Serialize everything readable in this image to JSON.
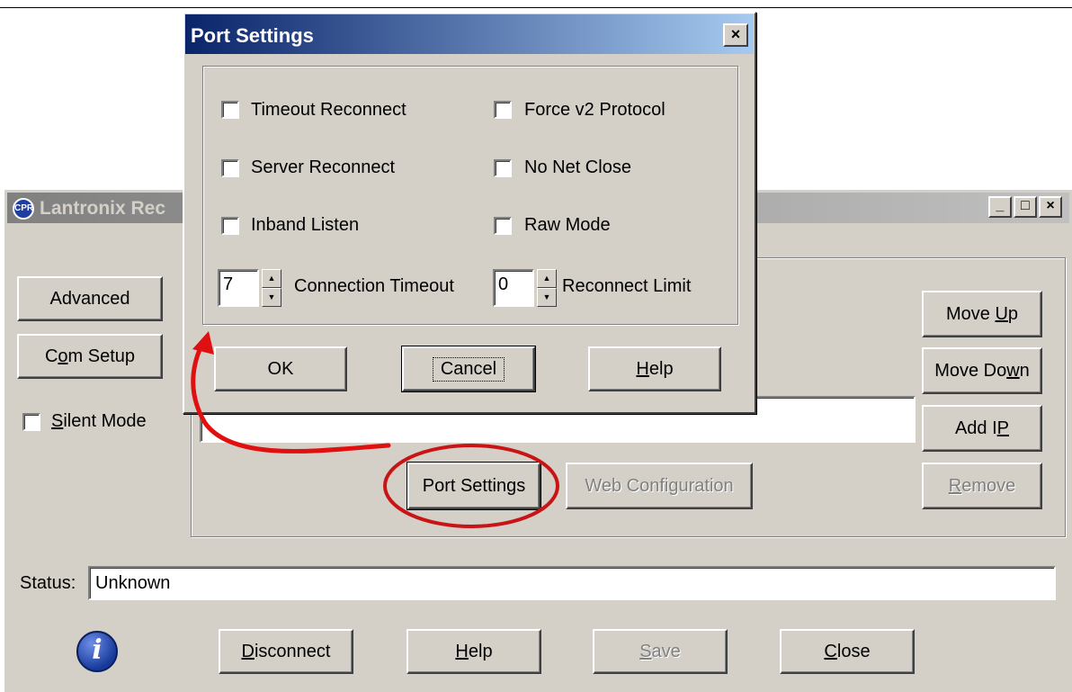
{
  "main_window": {
    "title": "Lantronix Rec",
    "buttons": {
      "advanced": "Advanced",
      "com_setup_pre": "C",
      "com_setup_key": "o",
      "com_setup_post": "m Setup",
      "move_up_pre": "Move ",
      "move_up_key": "U",
      "move_up_post": "p",
      "move_down_pre": "Move Do",
      "move_down_key": "w",
      "move_down_post": "n",
      "add_ip_pre": "Add I",
      "add_ip_key": "P",
      "remove_key": "R",
      "remove_post": "emove",
      "port_settings": "Port Settings",
      "web_configuration": "Web Configuration"
    },
    "silent_mode_key": "S",
    "silent_mode_post": "ilent Mode",
    "status_label": "Status:",
    "status_value": "Unknown",
    "bottom": {
      "disconnect_key": "D",
      "disconnect_post": "isconnect",
      "help_key": "H",
      "help_post": "elp",
      "save_key": "S",
      "save_post": "ave",
      "close_key": "C",
      "close_post": "lose"
    }
  },
  "dialog": {
    "title": "Port Settings",
    "checkboxes": {
      "timeout_reconnect": "Timeout Reconnect",
      "server_reconnect": "Server Reconnect",
      "inband_listen": "Inband Listen",
      "force_v2": "Force v2 Protocol",
      "no_net_close": "No Net Close",
      "raw_mode": "Raw Mode"
    },
    "connection_timeout_value": "7",
    "connection_timeout_label": "Connection Timeout",
    "reconnect_limit_value": "0",
    "reconnect_limit_label": "Reconnect Limit",
    "ok": "OK",
    "cancel": "Cancel",
    "help_key": "H",
    "help_post": "elp"
  },
  "annotation_color": "#e01010"
}
